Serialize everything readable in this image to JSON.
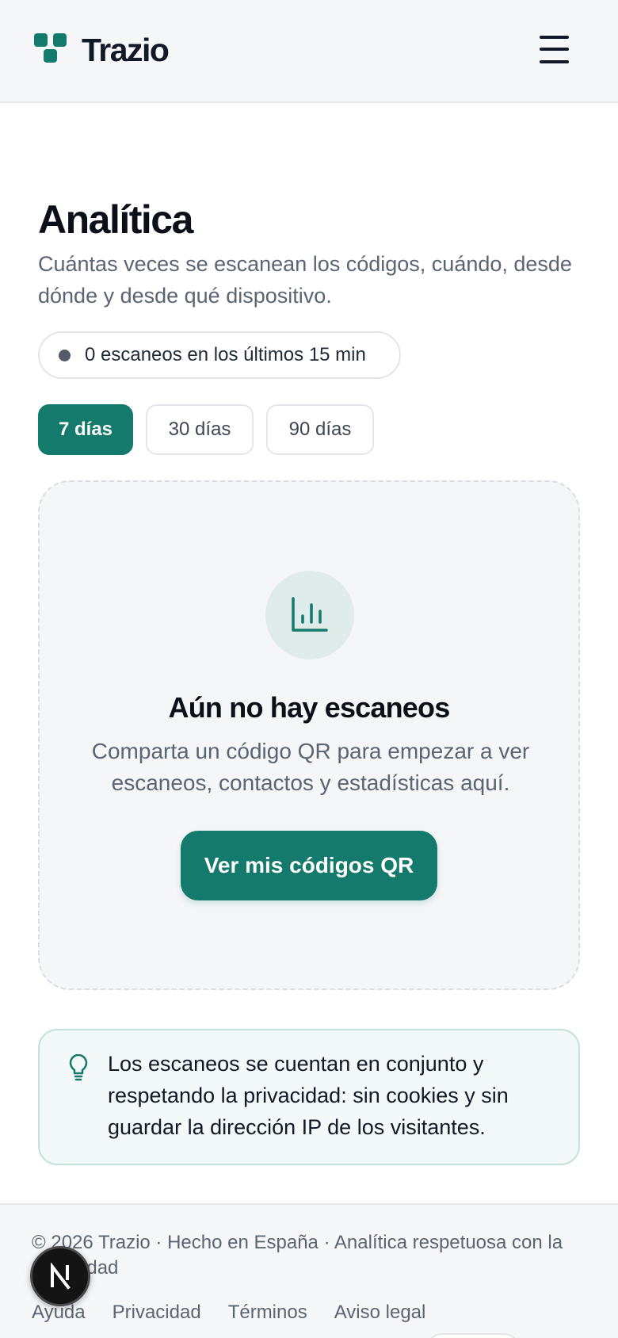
{
  "header": {
    "brand": "Trazio",
    "menu_icon": "hamburger-menu-icon",
    "brand_color": "#147a6c"
  },
  "page": {
    "title": "Analítica",
    "subtitle": "Cuántas veces se escanean los códigos, cuándo, desde dónde y desde qué dispositivo.",
    "live_status": "0 escaneos en los últimos 15 min"
  },
  "range_tabs": [
    {
      "label": "7 días",
      "active": true
    },
    {
      "label": "30 días",
      "active": false
    },
    {
      "label": "90 días",
      "active": false
    }
  ],
  "empty_state": {
    "icon": "bar-chart-icon",
    "title": "Aún no hay escaneos",
    "description": "Comparta un código QR para empezar a ver escaneos, contactos y estadísticas aquí.",
    "button_label": "Ver mis códigos QR"
  },
  "info": {
    "icon": "lightbulb-icon",
    "text": "Los escaneos se cuentan en conjunto y respetando la privacidad: sin cookies y sin guardar la dirección IP de los visitantes."
  },
  "footer": {
    "copyright": "© 2026 Trazio · Hecho en España · Analítica respetuosa con la privacidad",
    "links": [
      "Ayuda",
      "Privacidad",
      "Términos",
      "Aviso legal"
    ]
  },
  "dev_badge": {
    "icon": "nextjs-logo-icon"
  }
}
